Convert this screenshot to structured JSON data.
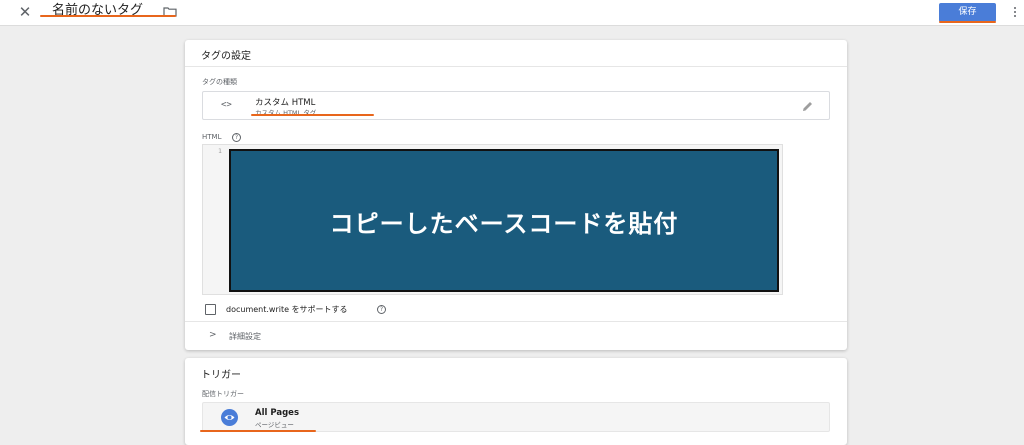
{
  "topbar": {
    "close_icon": "close-icon",
    "title": "名前のないタグ",
    "folder_icon": "folder-icon",
    "save_label": "保存",
    "more_icon": "more-vert-icon"
  },
  "tag_config": {
    "header": "タグの設定",
    "type_label": "タグの種類",
    "type_name": "カスタム HTML",
    "type_sub": "カスタム HTML タグ",
    "code_icon_glyph": "<>",
    "html_label": "HTML",
    "help_glyph": "?",
    "line_number": "1",
    "overlay_text": "コピーしたベースコードを貼付",
    "checkbox_label": "document.write をサポートする",
    "checkbox_checked": false,
    "advanced_chevron": ">",
    "advanced_label": "詳細設定"
  },
  "trigger": {
    "header": "トリガー",
    "firing_label": "配信トリガー",
    "name": "All Pages",
    "sub": "ページビュー"
  },
  "colors": {
    "accent_blue": "#4a7dd8",
    "highlight_orange": "#e8661c",
    "overlay_bg": "#1a5b7d"
  }
}
